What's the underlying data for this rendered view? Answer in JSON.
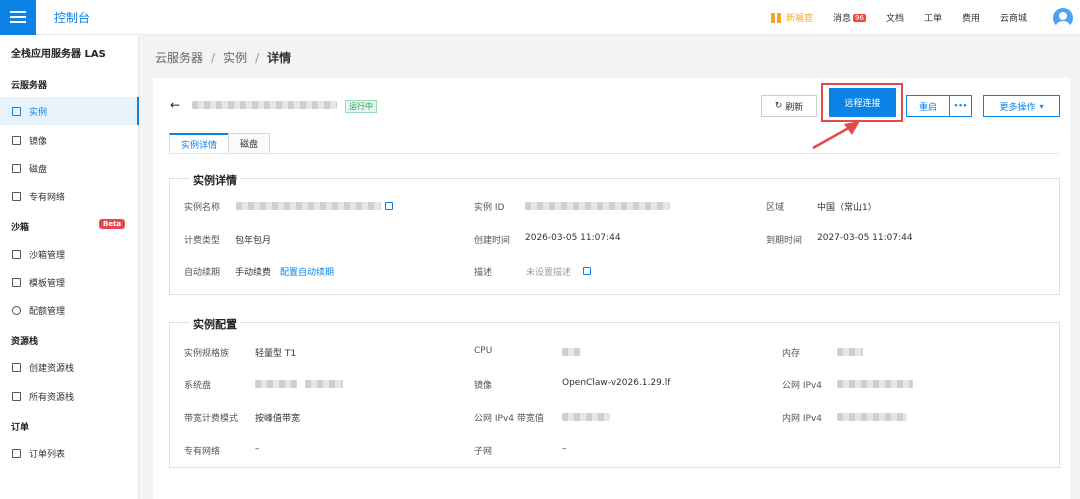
{
  "topbar": {
    "brand": "控制台",
    "nav": {
      "newbie": "新福官",
      "messages": "消息",
      "messages_badge": "96",
      "docs": "文档",
      "tickets": "工单",
      "billing": "费用",
      "store": "云商城"
    }
  },
  "sidebar": {
    "title": "全栈应用服务器 LAS",
    "group_server": "云服务器",
    "item_instance": "实例",
    "item_image": "镜像",
    "item_disk": "磁盘",
    "item_vpc": "专有网络",
    "group_sandbox": "沙箱",
    "beta": "Beta",
    "item_sandbox_mgmt": "沙箱管理",
    "item_template_mgmt": "模板管理",
    "item_quota_mgmt": "配额管理",
    "group_stack": "资源栈",
    "item_create_stack": "创建资源栈",
    "item_all_stack": "所有资源栈",
    "group_order": "订单",
    "item_order_list": "订单列表"
  },
  "breadcrumb": {
    "a": "云服务器",
    "b": "实例",
    "c": "详情",
    "sep": "/"
  },
  "header": {
    "status": "运行中",
    "refresh": "刷新",
    "remote_connect": "远程连接",
    "restart": "重启",
    "more_dots": "•••",
    "more_actions": "更多操作"
  },
  "tabs": {
    "detail": "实例详情",
    "disk": "磁盘"
  },
  "detail": {
    "title": "实例详情",
    "name_label": "实例名称",
    "id_label": "实例 ID",
    "region_label": "区域",
    "region_value": "中国（常山1）",
    "billing_label": "计费类型",
    "billing_value": "包年包月",
    "created_label": "创建时间",
    "created_value": "2026-03-05 11:07:44",
    "expire_label": "到期时间",
    "expire_value": "2027-03-05 11:07:44",
    "renew_label": "自动续期",
    "renew_value": "手动续费",
    "renew_link": "配置自动续期",
    "desc_label": "描述",
    "desc_value": "未设置描述"
  },
  "config": {
    "title": "实例配置",
    "family_label": "实例规格族",
    "family_value": "轻量型 T1",
    "cpu_label": "CPU",
    "mem_label": "内存",
    "sysdisk_label": "系统盘",
    "image_label": "镜像",
    "image_value": "OpenClaw-v2026.1.29.lf",
    "pubip_label": "公网 IPv4",
    "bwmode_label": "带宽计费模式",
    "bwmode_value": "按峰值带宽",
    "pubbw_label": "公网 IPv4 带宽值",
    "privip_label": "内网 IPv4",
    "vpc_label": "专有网络",
    "vpc_value": "–",
    "subnet_label": "子网",
    "subnet_value": "–"
  }
}
